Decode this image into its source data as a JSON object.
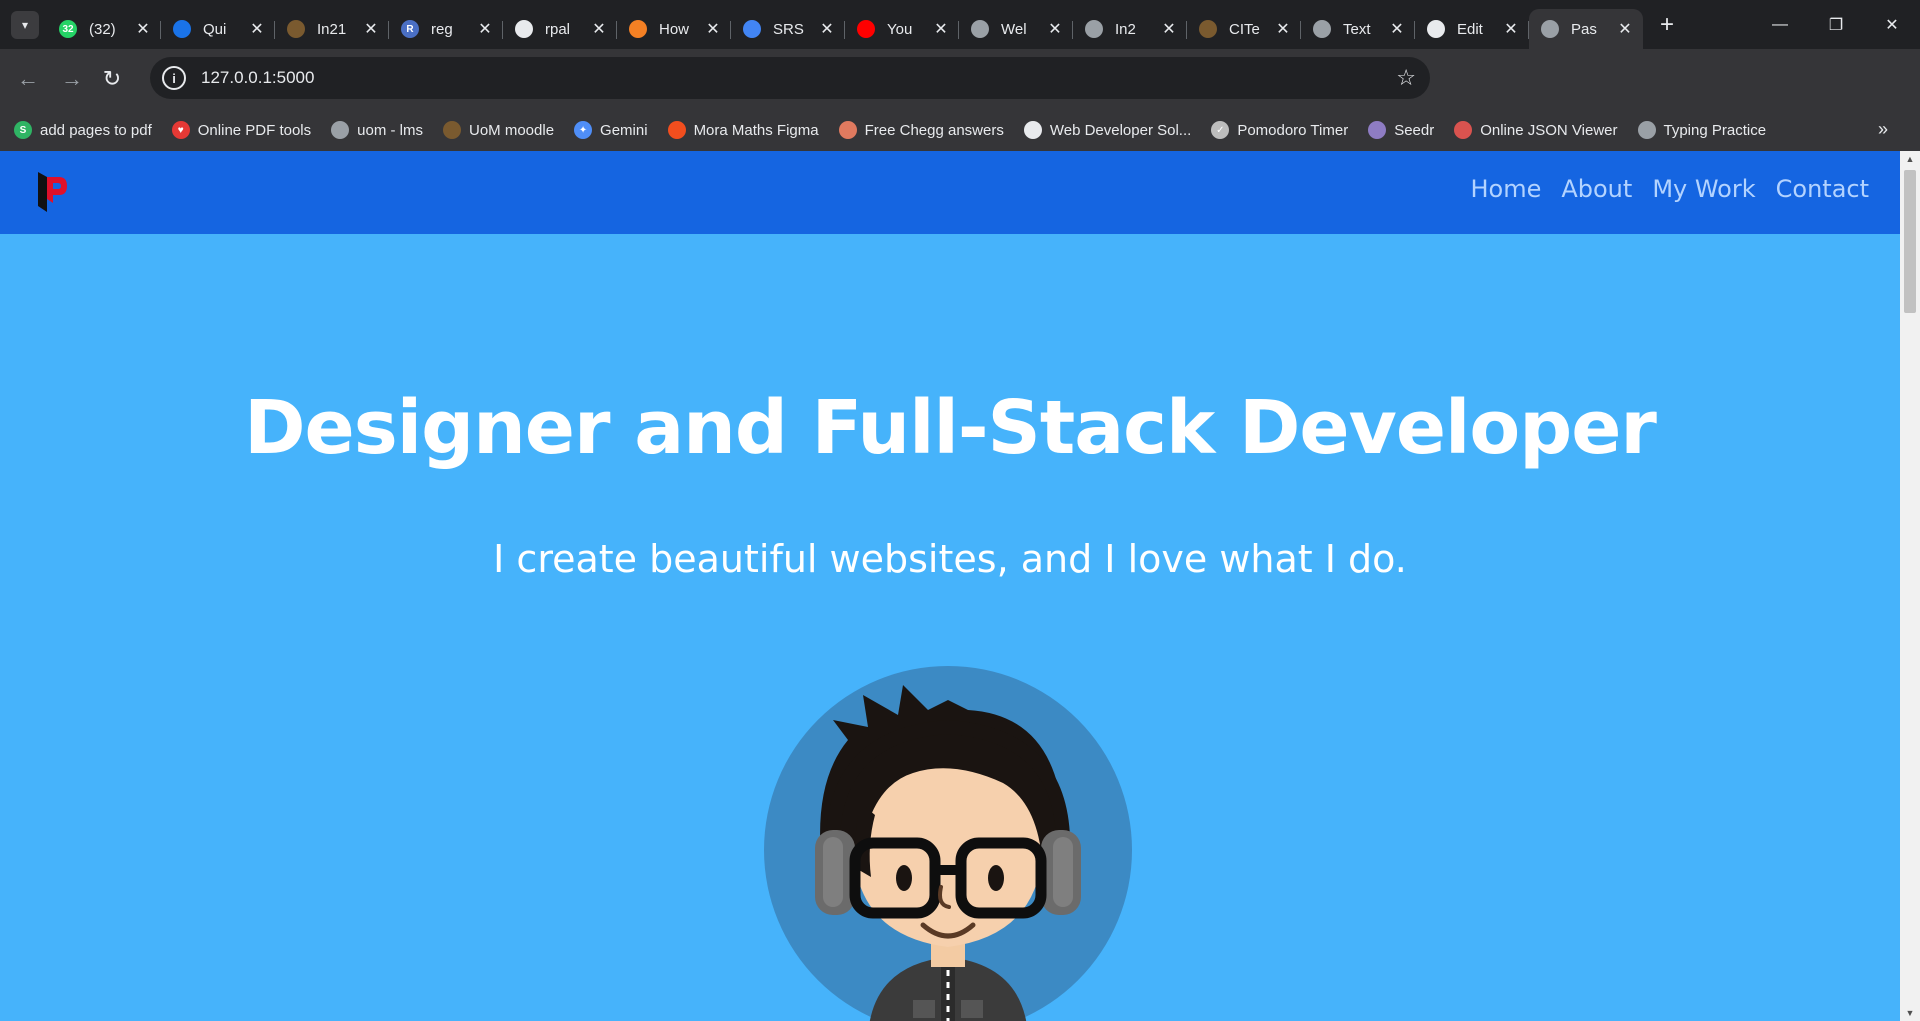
{
  "browser": {
    "tabs": [
      {
        "title": "(32)",
        "favicon": "whatsapp-icon",
        "color": "#25d366",
        "badge": "32"
      },
      {
        "title": "Qui",
        "favicon": "onedrive-icon",
        "color": "#1a73e8",
        "badge": ""
      },
      {
        "title": "In21",
        "favicon": "uom-icon",
        "color": "#7a5a2f",
        "badge": ""
      },
      {
        "title": "reg",
        "favicon": "r-icon",
        "color": "#4a6fc4",
        "badge": "R"
      },
      {
        "title": "rpal",
        "favicon": "github-icon",
        "color": "#e8eaed",
        "badge": ""
      },
      {
        "title": "How",
        "favicon": "stackoverflow-icon",
        "color": "#f48024",
        "badge": ""
      },
      {
        "title": "SRS",
        "favicon": "google-docs-icon",
        "color": "#4285f4",
        "badge": ""
      },
      {
        "title": "You",
        "favicon": "youtube-icon",
        "color": "#ff0000",
        "badge": ""
      },
      {
        "title": "Wel",
        "favicon": "openai-icon",
        "color": "#9aa0a6",
        "badge": ""
      },
      {
        "title": "In2",
        "favicon": "openai-icon",
        "color": "#9aa0a6",
        "badge": ""
      },
      {
        "title": "CITe",
        "favicon": "uom-icon",
        "color": "#7a5a2f",
        "badge": ""
      },
      {
        "title": "Text",
        "favicon": "openai-icon",
        "color": "#9aa0a6",
        "badge": ""
      },
      {
        "title": "Edit",
        "favicon": "github-icon",
        "color": "#e8eaed",
        "badge": ""
      },
      {
        "title": "Pas",
        "favicon": "globe-icon",
        "color": "#9aa0a6",
        "badge": ""
      }
    ],
    "active_tab_index": 13,
    "url": "127.0.0.1:5000",
    "bookmarks": [
      {
        "label": "add pages to pdf",
        "icon": "smallpdf-icon",
        "color": "#2fb464",
        "glyph": "S"
      },
      {
        "label": "Online PDF tools",
        "icon": "heart-icon",
        "color": "#e53935",
        "glyph": "♥"
      },
      {
        "label": "uom - lms",
        "icon": "globe-icon",
        "color": "#9aa0a6",
        "glyph": ""
      },
      {
        "label": "UoM moodle",
        "icon": "uom-icon",
        "color": "#7a5a2f",
        "glyph": ""
      },
      {
        "label": "Gemini",
        "icon": "gemini-icon",
        "color": "#4f8ef7",
        "glyph": "✦"
      },
      {
        "label": "Mora Maths Figma",
        "icon": "figma-icon",
        "color": "#f24e1e",
        "glyph": ""
      },
      {
        "label": "Free Chegg answers",
        "icon": "books-icon",
        "color": "#e07a5f",
        "glyph": ""
      },
      {
        "label": "Web Developer Sol...",
        "icon": "github-icon",
        "color": "#e8eaed",
        "glyph": ""
      },
      {
        "label": "Pomodoro Timer",
        "icon": "check-circle-icon",
        "color": "#bdbdbd",
        "glyph": "✓"
      },
      {
        "label": "Seedr",
        "icon": "seedr-icon",
        "color": "#8e7cc3",
        "glyph": ""
      },
      {
        "label": "Online JSON Viewer",
        "icon": "json-icon",
        "color": "#d9534f",
        "glyph": ""
      },
      {
        "label": "Typing Practice",
        "icon": "typing-icon",
        "color": "#9aa0a6",
        "glyph": ""
      }
    ]
  },
  "site": {
    "nav": [
      "Home",
      "About",
      "My Work",
      "Contact"
    ],
    "hero": {
      "title": "Designer and Full-Stack Developer",
      "subtitle": "I create beautiful websites, and I love what I do."
    },
    "colors": {
      "background": "#46b3fb",
      "nav_bar": "#1565e1",
      "nav_link": "#b3d3ff"
    }
  }
}
